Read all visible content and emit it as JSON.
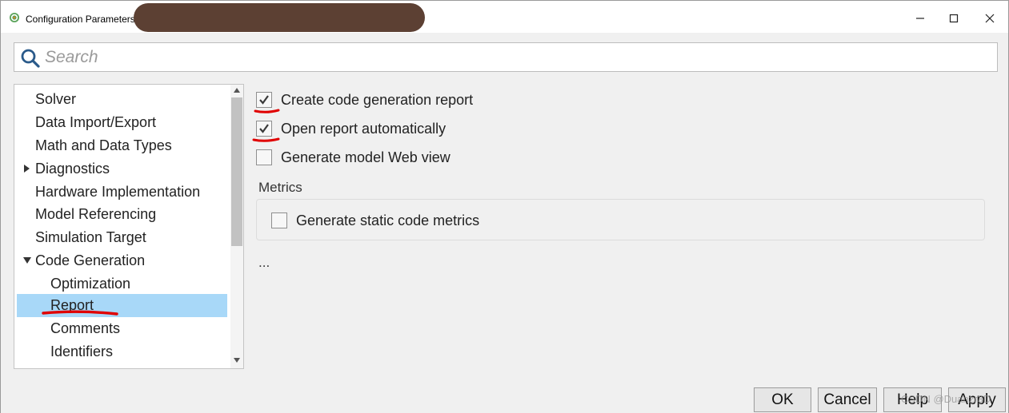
{
  "window": {
    "title": "Configuration Parameters",
    "controls": {
      "minimize": "minimize",
      "maximize": "maximize",
      "close": "close"
    }
  },
  "search": {
    "placeholder": "Search",
    "value": ""
  },
  "nav": {
    "items": [
      {
        "label": "Solver",
        "level": 0,
        "expander": "none",
        "selected": false
      },
      {
        "label": "Data Import/Export",
        "level": 0,
        "expander": "none",
        "selected": false
      },
      {
        "label": "Math and Data Types",
        "level": 0,
        "expander": "none",
        "selected": false
      },
      {
        "label": "Diagnostics",
        "level": 0,
        "expander": "collapsed",
        "selected": false
      },
      {
        "label": "Hardware Implementation",
        "level": 0,
        "expander": "none",
        "selected": false
      },
      {
        "label": "Model Referencing",
        "level": 0,
        "expander": "none",
        "selected": false
      },
      {
        "label": "Simulation Target",
        "level": 0,
        "expander": "none",
        "selected": false
      },
      {
        "label": "Code Generation",
        "level": 0,
        "expander": "expanded",
        "selected": false
      },
      {
        "label": "Optimization",
        "level": 1,
        "expander": "none",
        "selected": false
      },
      {
        "label": "Report",
        "level": 1,
        "expander": "none",
        "selected": true
      },
      {
        "label": "Comments",
        "level": 1,
        "expander": "none",
        "selected": false
      },
      {
        "label": "Identifiers",
        "level": 1,
        "expander": "none",
        "selected": false
      }
    ]
  },
  "content": {
    "options": [
      {
        "label": "Create code generation report",
        "checked": true
      },
      {
        "label": "Open report automatically",
        "checked": true
      },
      {
        "label": "Generate model Web view",
        "checked": false
      }
    ],
    "metrics": {
      "title": "Metrics",
      "options": [
        {
          "label": "Generate static code metrics",
          "checked": false
        }
      ]
    },
    "more": "..."
  },
  "buttons": {
    "ok": "OK",
    "cancel": "Cancel",
    "help": "Help",
    "apply": "Apply"
  },
  "watermark": "CSDN @Duanzr3D",
  "colors": {
    "selection": "#a8d8f8",
    "annotation": "#e00000",
    "redaction": "#5c4033",
    "checkmark": "#3a3a3a"
  }
}
